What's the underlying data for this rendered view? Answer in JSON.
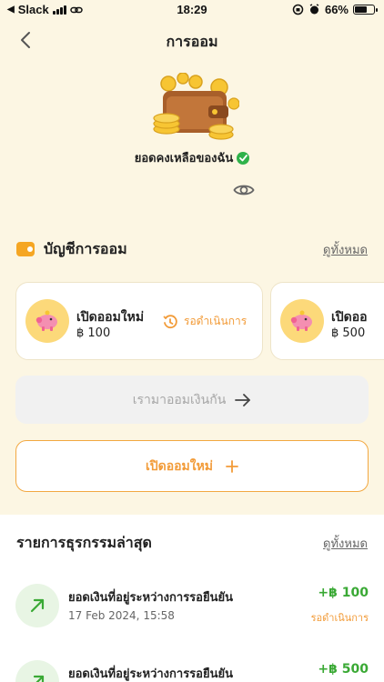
{
  "status_bar": {
    "carrier": "Slack",
    "time": "18:29",
    "battery": "66%"
  },
  "nav": {
    "title": "การออม"
  },
  "balance": {
    "label": "ยอดคงเหลือของฉัน"
  },
  "savings_section": {
    "title": "บัญชีการออม",
    "see_all": "ดูทั้งหมด",
    "cards": [
      {
        "title": "เปิดออมใหม่",
        "amount": "฿ 100",
        "status": "รอดำเนินการ"
      },
      {
        "title": "เปิดออ",
        "amount": "฿ 500"
      }
    ]
  },
  "buttons": {
    "start_saving": "เรามาออมเงินกัน",
    "open_new": "เปิดออมใหม่"
  },
  "transactions": {
    "title": "รายการธุรกรรมล่าสุด",
    "see_all": "ดูทั้งหมด",
    "items": [
      {
        "name": "ยอดเงินที่อยู่ระหว่างการรอยืนยัน",
        "date": "17 Feb 2024, 15:58",
        "amount": "+฿ 100",
        "status": "รอดำเนินการ"
      },
      {
        "name": "ยอดเงินที่อยู่ระหว่างการรอยืนยัน",
        "amount": "+฿ 500"
      }
    ]
  },
  "colors": {
    "background": "#fcf6e3",
    "accent": "#f29b38",
    "positive": "#3aa935"
  }
}
